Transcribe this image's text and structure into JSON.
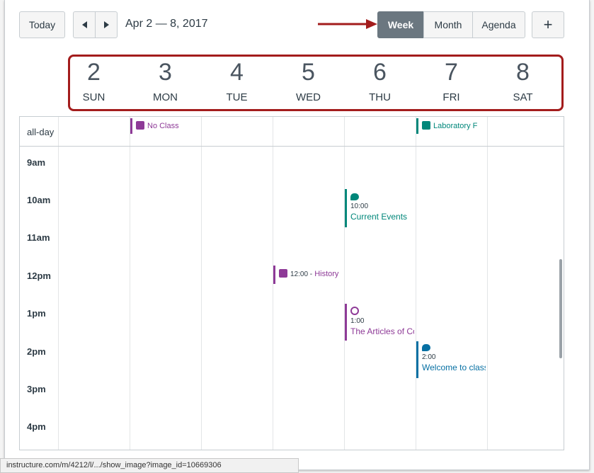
{
  "toolbar": {
    "today_label": "Today",
    "date_range": "Apr 2 — 8, 2017",
    "views": [
      "Week",
      "Month",
      "Agenda"
    ],
    "active_view": "Week",
    "add_label": "+"
  },
  "days": [
    {
      "num": "2",
      "name": "SUN"
    },
    {
      "num": "3",
      "name": "MON"
    },
    {
      "num": "4",
      "name": "TUE"
    },
    {
      "num": "5",
      "name": "WED"
    },
    {
      "num": "6",
      "name": "THU"
    },
    {
      "num": "7",
      "name": "FRI"
    },
    {
      "num": "8",
      "name": "SAT"
    }
  ],
  "allday_label": "all-day",
  "hours": [
    "9am",
    "10am",
    "11am",
    "12pm",
    "1pm",
    "2pm",
    "3pm",
    "4pm"
  ],
  "events": {
    "no_class": "No Class",
    "laboratory": "Laboratory F",
    "history_time": "12:00 -",
    "history_title": "History",
    "current_events_time": "10:00",
    "current_events_title": "Current Events",
    "articles_time": "1:00",
    "articles_title": "The Articles of Co",
    "welcome_time": "2:00",
    "welcome_title": "Welcome to class"
  },
  "colors": {
    "highlight": "#a31c1c",
    "purple": "#8e3a97",
    "teal": "#00877a",
    "blue": "#0770a3"
  },
  "status_url": "instructure.com/m/4212/l/.../show_image?image_id=10669306"
}
